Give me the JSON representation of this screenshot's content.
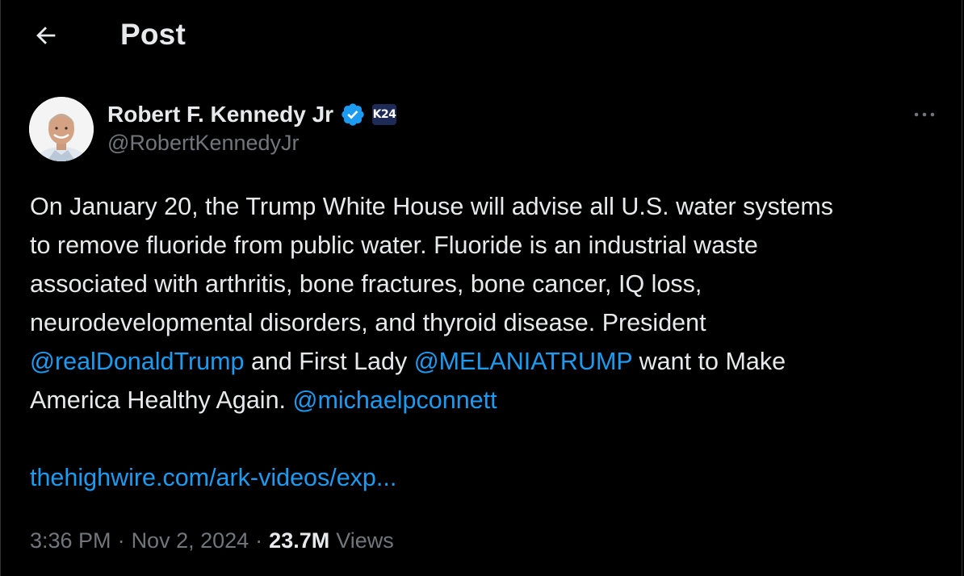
{
  "header": {
    "title": "Post"
  },
  "author": {
    "display_name": "Robert F. Kennedy Jr",
    "handle": "@RobertKennedyJr",
    "affiliation_badge": "K24",
    "verified_color": "#1d9bf0"
  },
  "tweet": {
    "lines": [
      "On January 20, the Trump White House will advise all U.S. water systems",
      "to remove fluoride from public water. Fluoride is an industrial waste",
      "associated with arthritis, bone fractures, bone cancer, IQ loss,",
      "neurodevelopmental disorders, and thyroid disease. President"
    ],
    "mention_1": "@realDonaldTrump",
    "text_mid": " and First Lady ",
    "mention_2": "@MELANIATRUMP",
    "text_after": " want to Make",
    "text_last": "America Healthy Again. ",
    "mention_3": "@michaelpconnett",
    "link": "thehighwire.com/ark-videos/exp..."
  },
  "meta": {
    "time": "3:36 PM",
    "sep": "·",
    "date": "Nov 2, 2024",
    "views_count": "23.7M",
    "views_label": "Views"
  },
  "colors": {
    "background": "#000000",
    "text": "#e7e9ea",
    "secondary": "#71767b",
    "accent": "#1d9bf0"
  },
  "icons": {
    "back": "arrow-left-icon",
    "more": "more-horizontal-icon",
    "verified": "verified-badge-icon"
  }
}
